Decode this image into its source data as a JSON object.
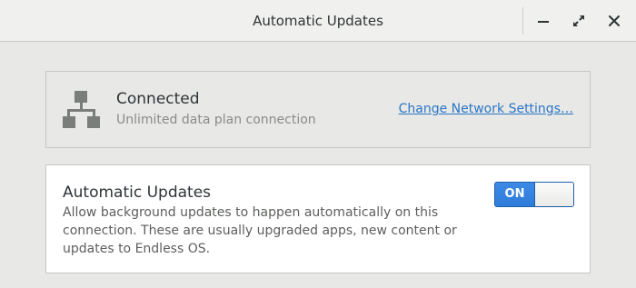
{
  "window": {
    "title": "Automatic Updates",
    "controls": [
      "minimize-icon",
      "maximize-icon",
      "close-icon"
    ]
  },
  "network": {
    "icon": "network-icon",
    "status": "Connected",
    "detail": "Unlimited data plan connection",
    "settings_link": "Change Network Settings…"
  },
  "updates": {
    "title": "Automatic Updates",
    "description": "Allow background updates to happen automatically on this connection. These are usually upgraded apps, new content or updates to Endless OS.",
    "toggle_label": "ON",
    "toggle_state": "on"
  },
  "colors": {
    "accent": "#3584e4",
    "link": "#2a76c6",
    "background": "#e8e8e7",
    "card": "#ffffff"
  }
}
